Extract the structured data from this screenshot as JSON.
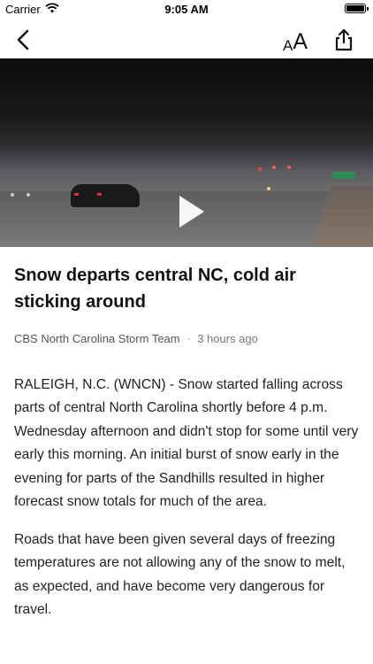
{
  "status_bar": {
    "carrier": "Carrier",
    "time": "9:05 AM"
  },
  "nav": {
    "font_small": "A",
    "font_big": "A"
  },
  "article": {
    "title": "Snow departs central NC, cold air sticking around",
    "author": "CBS North Carolina Storm Team",
    "separator": "·",
    "published": "3 hours ago",
    "paragraphs": [
      "RALEIGH, N.C. (WNCN) - Snow started falling across parts of central North Carolina shortly before 4 p.m. Wednesday afternoon and didn't stop for some until very early this morning. An initial burst of snow early in the evening for parts of the Sandhills resulted in higher forecast snow totals for much of the area.",
      "Roads that have been given several days of freezing temperatures are not allowing any of the snow to melt, as expected, and have become very dangerous for travel."
    ]
  },
  "icons": {
    "wifi": "wifi-icon",
    "battery": "battery-icon",
    "back": "chevron-left-icon",
    "share": "share-icon",
    "play": "play-icon"
  }
}
